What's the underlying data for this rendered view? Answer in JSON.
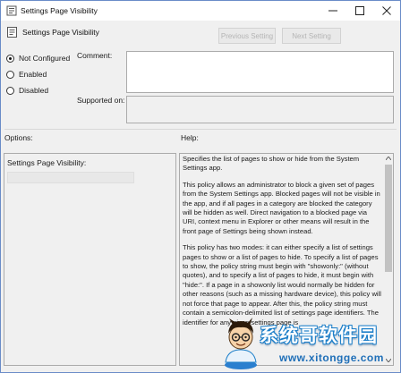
{
  "window": {
    "title": "Settings Page Visibility",
    "controls": {
      "minimize": "minimize-icon",
      "maximize": "maximize-icon",
      "close": "close-icon"
    }
  },
  "header": {
    "policy_name": "Settings Page Visibility",
    "previous_label": "Previous Setting",
    "next_label": "Next Setting"
  },
  "state": {
    "options": [
      {
        "label": "Not Configured",
        "checked": true
      },
      {
        "label": "Enabled",
        "checked": false
      },
      {
        "label": "Disabled",
        "checked": false
      }
    ]
  },
  "fields": {
    "comment_label": "Comment:",
    "supported_label": "Supported on:"
  },
  "options_panel": {
    "heading": "Options:",
    "setting_label": "Settings Page Visibility:"
  },
  "help_panel": {
    "heading": "Help:",
    "paragraphs": [
      "Specifies the list of pages to show or hide from the System Settings app.",
      "This policy allows an administrator to block a given set of pages from the System Settings app. Blocked pages will not be visible in the app, and if all pages in a category are blocked the category will be hidden as well. Direct navigation to a blocked page via URI, context menu in Explorer or other means will result in the front page of Settings being shown instead.",
      "This policy has two modes: it can either specify a list of settings pages to show or a list of pages to hide. To specify a list of pages to show, the policy string must begin with \"showonly:\" (without quotes), and to specify a list of pages to hide, it must begin with \"hide:\". If a page in a showonly list would normally be hidden for other reasons (such as a missing hardware device), this policy will not force that page to appear. After this, the policy string must contain a semicolon-delimited list of settings page identifiers. The identifier for any given settings page is"
    ]
  },
  "watermark": {
    "title": "系统哥软件园",
    "url": "www.xitongge.com"
  },
  "colors": {
    "window_border": "#6a8cc8",
    "background": "#f0f0f0",
    "watermark_blue": "#1d7fc9"
  }
}
